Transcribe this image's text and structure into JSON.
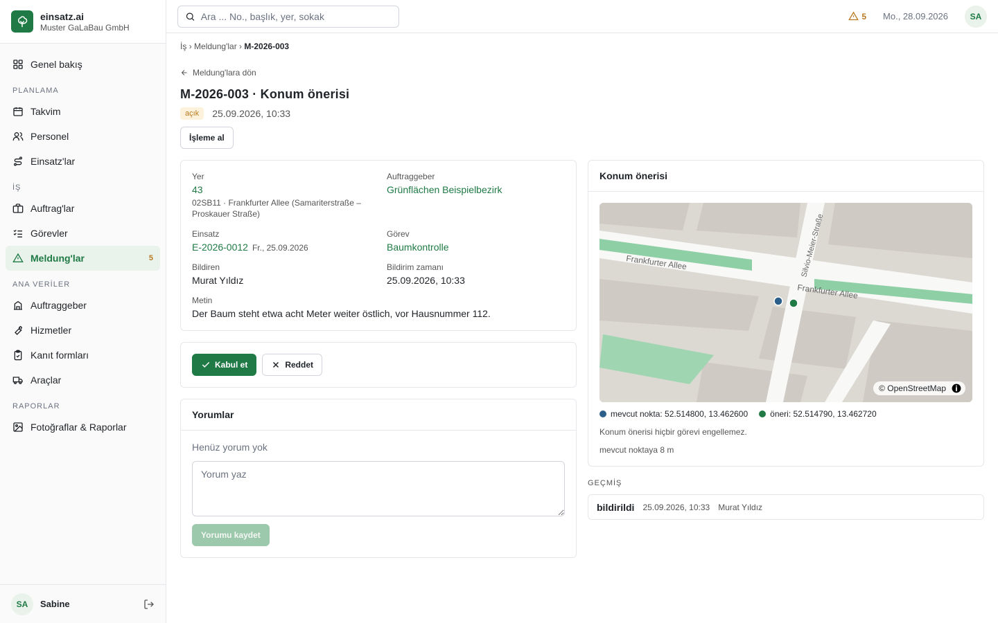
{
  "brand": {
    "name": "einsatz.ai",
    "org": "Muster GaLaBau GmbH"
  },
  "nav": {
    "overview": "Genel bakış",
    "sections": {
      "planning": "PLANLAMA",
      "work": "İŞ",
      "master": "ANA VERİLER",
      "reports": "RAPORLAR"
    },
    "calendar": "Takvim",
    "staff": "Personel",
    "einsatze": "Einsatz'lar",
    "orders": "Auftrag'lar",
    "tasks": "Görevler",
    "reports_item": "Meldung'lar",
    "reports_badge": "5",
    "clients": "Auftraggeber",
    "services": "Hizmetler",
    "proof_forms": "Kanıt formları",
    "vehicles": "Araçlar",
    "photos": "Fotoğraflar & Raporlar"
  },
  "user": {
    "initials": "SA",
    "name": "Sabine"
  },
  "topbar": {
    "search_placeholder": "Ara ... No., başlık, yer, sokak",
    "alert_count": "5",
    "date": "Mo., 28.09.2026",
    "avatar": "SA"
  },
  "breadcrumb": {
    "root": "İş",
    "sep": "›",
    "list": "Meldung'lar",
    "current": "M-2026-003"
  },
  "page": {
    "back_label": "Meldung'lara dön",
    "title": "M-2026-003 · Konum önerisi",
    "status": "açık",
    "created": "25.09.2026, 10:33",
    "process_button": "İşleme al"
  },
  "details": {
    "location_label": "Yer",
    "location_value": "43",
    "location_sub": "02SB11 · Frankfurter Allee (Samariterstraße – Proskauer Straße)",
    "client_label": "Auftraggeber",
    "client_value": "Grünflächen Beispielbezirk",
    "einsatz_label": "Einsatz",
    "einsatz_value": "E-2026-0012",
    "einsatz_date": "Fr., 25.09.2026",
    "task_label": "Görev",
    "task_value": "Baumkontrolle",
    "reporter_label": "Bildiren",
    "reporter_value": "Murat Yıldız",
    "time_label": "Bildirim zamanı",
    "time_value": "25.09.2026, 10:33",
    "text_label": "Metin",
    "text_value": "Der Baum steht etwa acht Meter weiter östlich, vor Hausnummer 112."
  },
  "actions": {
    "accept": "Kabul et",
    "reject": "Reddet"
  },
  "comments": {
    "title": "Yorumlar",
    "empty": "Henüz yorum yok",
    "placeholder": "Yorum yaz",
    "save": "Yorumu kaydet"
  },
  "map": {
    "title": "Konum önerisi",
    "street_a": "Frankfurter Allee",
    "street_b": "Frankfurter Allee",
    "street_c": "Silvio-Meier-Straße",
    "attribution": "© OpenStreetMap",
    "current_label": "mevcut nokta: 52.514800, 13.462600",
    "proposal_label": "öneri: 52.514790, 13.462720",
    "note": "Konum önerisi hiçbir görevi engellemez.",
    "distance": "mevcut noktaya 8 m",
    "current_color": "#2b5f8a",
    "proposal_color": "#1f7a45"
  },
  "history": {
    "title": "GEÇMİŞ",
    "event": "bildirildi",
    "time": "25.09.2026, 10:33",
    "actor": "Murat Yıldız"
  }
}
